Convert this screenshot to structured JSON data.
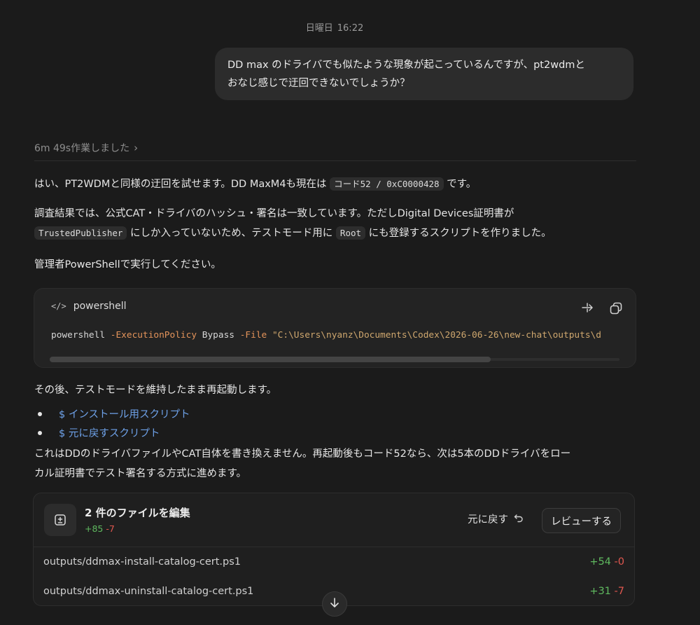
{
  "timestamp": {
    "day": "日曜日",
    "time": "16:22"
  },
  "user_message": {
    "line1": "DD max のドライバでも似たような現象が起こっているんですが、pt2wdmと",
    "line2": "おなじ感じで迂回できないでしょうか？"
  },
  "worked": {
    "label": "6m 49s作業しました"
  },
  "para1": {
    "a": "はい、PT2WDMと同様の迂回を試せます。DD MaxM4も現在は ",
    "code": "コード52 / 0xC0000428",
    "b": " です。"
  },
  "para2": {
    "a": "調査結果では、公式CAT・ドライバのハッシュ・署名は一致しています。ただしDigital Devices証明書が",
    "code1": "TrustedPublisher",
    "b": " にしか入っていないため、テストモード用に ",
    "code2": "Root",
    "c": " にも登録するスクリプトを作りました。"
  },
  "para3": {
    "text": "管理者PowerShellで実行してください。"
  },
  "code_block": {
    "language": "powershell",
    "cmd": "powershell",
    "p1": "-ExecutionPolicy",
    "v1": "Bypass",
    "p2": "-File",
    "path": "\"C:\\Users\\nyanz\\Documents\\Codex\\2026-06-26\\new-chat\\outputs\\d"
  },
  "para4": {
    "text": "その後、テストモードを維持したまま再起動します。"
  },
  "links": [
    {
      "label": "$ インストール用スクリプト"
    },
    {
      "label": "$ 元に戻すスクリプト"
    }
  ],
  "para5": {
    "line1": "これはDDのドライバファイルやCAT自体を書き換えません。再起動後もコード52なら、次は5本のDDドライバをロー",
    "line2": "カル証明書でテスト署名する方式に進めます。"
  },
  "files": {
    "title": "2 件のファイルを編集",
    "added": "+85",
    "removed": "-7",
    "revert_label": "元に戻す",
    "review_label": "レビューする",
    "rows": [
      {
        "path": "outputs/ddmax-install-catalog-cert.ps1",
        "added": "+54",
        "removed": "-0"
      },
      {
        "path": "outputs/ddmax-uninstall-catalog-cert.ps1",
        "added": "+31",
        "removed": "-7"
      }
    ]
  },
  "colors": {
    "background": "#1b1b1b",
    "link": "#6ea1e8",
    "added": "#5fb95f",
    "removed": "#e0574f",
    "param": "#e3935a"
  }
}
